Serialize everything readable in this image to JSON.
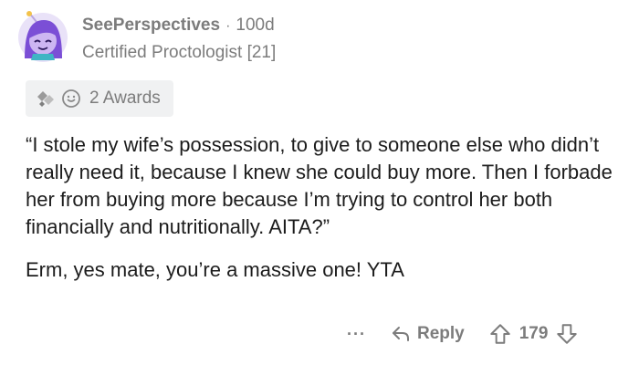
{
  "comment": {
    "username": "SeePerspectives",
    "separator": "·",
    "age": "100d",
    "flair": "Certified Proctologist [21]",
    "awards_label": "2 Awards",
    "paragraphs": [
      "“I stole my wife’s possession, to give to someone else who didn’t really need it, because I knew she could buy more. Then I forbade her from buying more because I’m trying to control her both financially and nutritionally. AITA?”",
      "Erm, yes mate, you’re a massive one! YTA"
    ],
    "actions": {
      "more": "···",
      "reply": "Reply",
      "score": "179"
    }
  },
  "colors": {
    "meta_text": "#7c7c7c",
    "body_text": "#1c1c1c",
    "awards_bg": "#f0f1f2",
    "avatar_hair": "#7b4fd6",
    "avatar_skin": "#cdb6f2"
  },
  "icons": [
    "avatar",
    "award-icon",
    "award-icon",
    "ellipsis-icon",
    "reply-arrow-icon",
    "upvote-arrow-icon",
    "downvote-arrow-icon"
  ]
}
